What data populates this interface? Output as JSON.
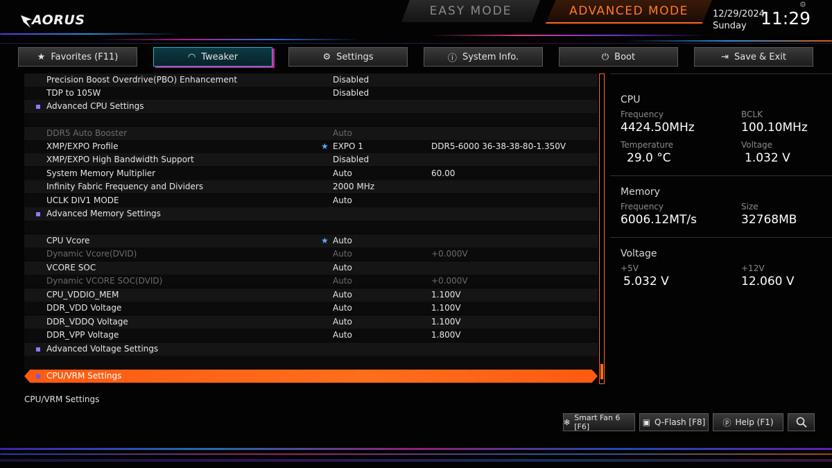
{
  "header": {
    "brand": "AORUS",
    "easy_mode": "EASY MODE",
    "advanced_mode": "ADVANCED MODE",
    "date": "12/29/2024",
    "day": "Sunday",
    "time": "11:29"
  },
  "tabs": [
    {
      "label": "Favorites (F11)",
      "icon": "star-plus-icon"
    },
    {
      "label": "Tweaker",
      "icon": "speedometer-icon",
      "active": true
    },
    {
      "label": "Settings",
      "icon": "gear-icon"
    },
    {
      "label": "System Info.",
      "icon": "info-icon"
    },
    {
      "label": "Boot",
      "icon": "power-icon"
    },
    {
      "label": "Save & Exit",
      "icon": "exit-icon"
    }
  ],
  "rows": [
    {
      "label": "Precision Boost Overdrive(PBO) Enhancement",
      "value": "Disabled",
      "extra": ""
    },
    {
      "label": "TDP to 105W",
      "value": "Disabled",
      "extra": ""
    },
    {
      "label": "Advanced CPU Settings",
      "value": "",
      "extra": ""
    },
    {
      "label": "",
      "value": "",
      "extra": ""
    },
    {
      "label": "DDR5 Auto Booster",
      "value": "Auto",
      "extra": ""
    },
    {
      "label": "XMP/EXPO Profile",
      "value": "EXPO 1",
      "extra": "DDR5-6000 36-38-38-80-1.350V"
    },
    {
      "label": "XMP/EXPO High Bandwidth Support",
      "value": "Disabled",
      "extra": ""
    },
    {
      "label": "System Memory Multiplier",
      "value": "Auto",
      "extra": "60.00"
    },
    {
      "label": "Infinity Fabric Frequency and Dividers",
      "value": "2000 MHz",
      "extra": ""
    },
    {
      "label": "UCLK DIV1 MODE",
      "value": "Auto",
      "extra": ""
    },
    {
      "label": "Advanced Memory Settings",
      "value": "",
      "extra": ""
    },
    {
      "label": "",
      "value": "",
      "extra": ""
    },
    {
      "label": "CPU Vcore",
      "value": "Auto",
      "extra": ""
    },
    {
      "label": "Dynamic Vcore(DVID)",
      "value": "Auto",
      "extra": "+0.000V"
    },
    {
      "label": "VCORE SOC",
      "value": "Auto",
      "extra": ""
    },
    {
      "label": "Dynamic VCORE SOC(DVID)",
      "value": "Auto",
      "extra": "+0.000V"
    },
    {
      "label": "CPU_VDDIO_MEM",
      "value": "Auto",
      "extra": "1.100V"
    },
    {
      "label": "DDR_VDD Voltage",
      "value": "Auto",
      "extra": "1.100V"
    },
    {
      "label": "DDR_VDDQ Voltage",
      "value": "Auto",
      "extra": "1.100V"
    },
    {
      "label": "DDR_VPP Voltage",
      "value": "Auto",
      "extra": "1.800V"
    },
    {
      "label": "Advanced Voltage Settings",
      "value": "",
      "extra": ""
    },
    {
      "label": "",
      "value": "",
      "extra": ""
    },
    {
      "label": "CPU/VRM Settings",
      "value": "",
      "extra": ""
    }
  ],
  "help_text": "CPU/VRM Settings",
  "panel": {
    "cpu": {
      "title": "CPU",
      "frequency_label": "Frequency",
      "frequency": "4424.50MHz",
      "bclk_label": "BCLK",
      "bclk": "100.10MHz",
      "temperature_label": "Temperature",
      "temperature": "29.0 °C",
      "voltage_label": "Voltage",
      "voltage": "1.032 V"
    },
    "memory": {
      "title": "Memory",
      "frequency_label": "Frequency",
      "frequency": "6006.12MT/s",
      "size_label": "Size",
      "size": "32768MB"
    },
    "voltage": {
      "title": "Voltage",
      "v5_label": "+5V",
      "v5": "5.032 V",
      "v12_label": "+12V",
      "v12": "12.060 V"
    }
  },
  "bottom_buttons": [
    {
      "label": "Smart Fan 6 [F6]",
      "icon": "fan-icon"
    },
    {
      "label": "Q-Flash [F8]",
      "icon": "chip-icon"
    },
    {
      "label": "Help (F1)",
      "icon": "help-icon"
    },
    {
      "label": "",
      "icon": "search-icon"
    }
  ],
  "colors": {
    "accent": "#ff6a1a",
    "tab_active": "#1fb6d0",
    "star": "#5fa8ff"
  }
}
